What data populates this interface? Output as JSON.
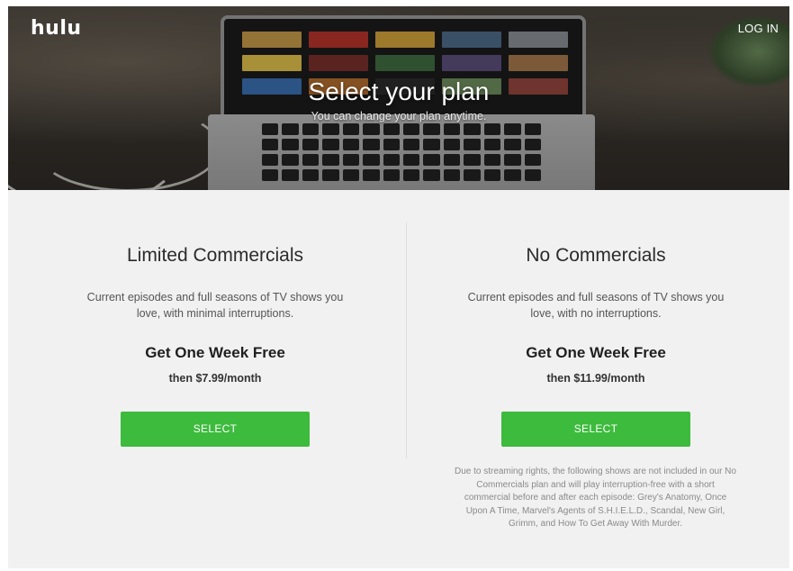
{
  "header": {
    "logo": "hulu",
    "login_label": "LOG IN"
  },
  "hero": {
    "title": "Select your plan",
    "subtitle": "You can change your plan anytime."
  },
  "plans": [
    {
      "name": "Limited Commercials",
      "description": "Current episodes and full seasons of TV shows you love, with minimal interruptions.",
      "offer": "Get One Week Free",
      "price": "then $7.99/month",
      "select_label": "SELECT"
    },
    {
      "name": "No Commercials",
      "description": "Current episodes and full seasons of TV shows you love, with no interruptions.",
      "offer": "Get One Week Free",
      "price": "then $11.99/month",
      "select_label": "SELECT"
    }
  ],
  "disclaimer": "Due to streaming rights, the following shows are not included in our No Commercials plan and will play interruption-free with a short commercial before and after each episode: Grey's Anatomy, Once Upon A Time, Marvel's Agents of S.H.I.E.L.D., Scandal, New Girl, Grimm, and How To Get Away With Murder.",
  "colors": {
    "accent_green": "#3dbb3d",
    "page_background": "#f1f1f1"
  }
}
